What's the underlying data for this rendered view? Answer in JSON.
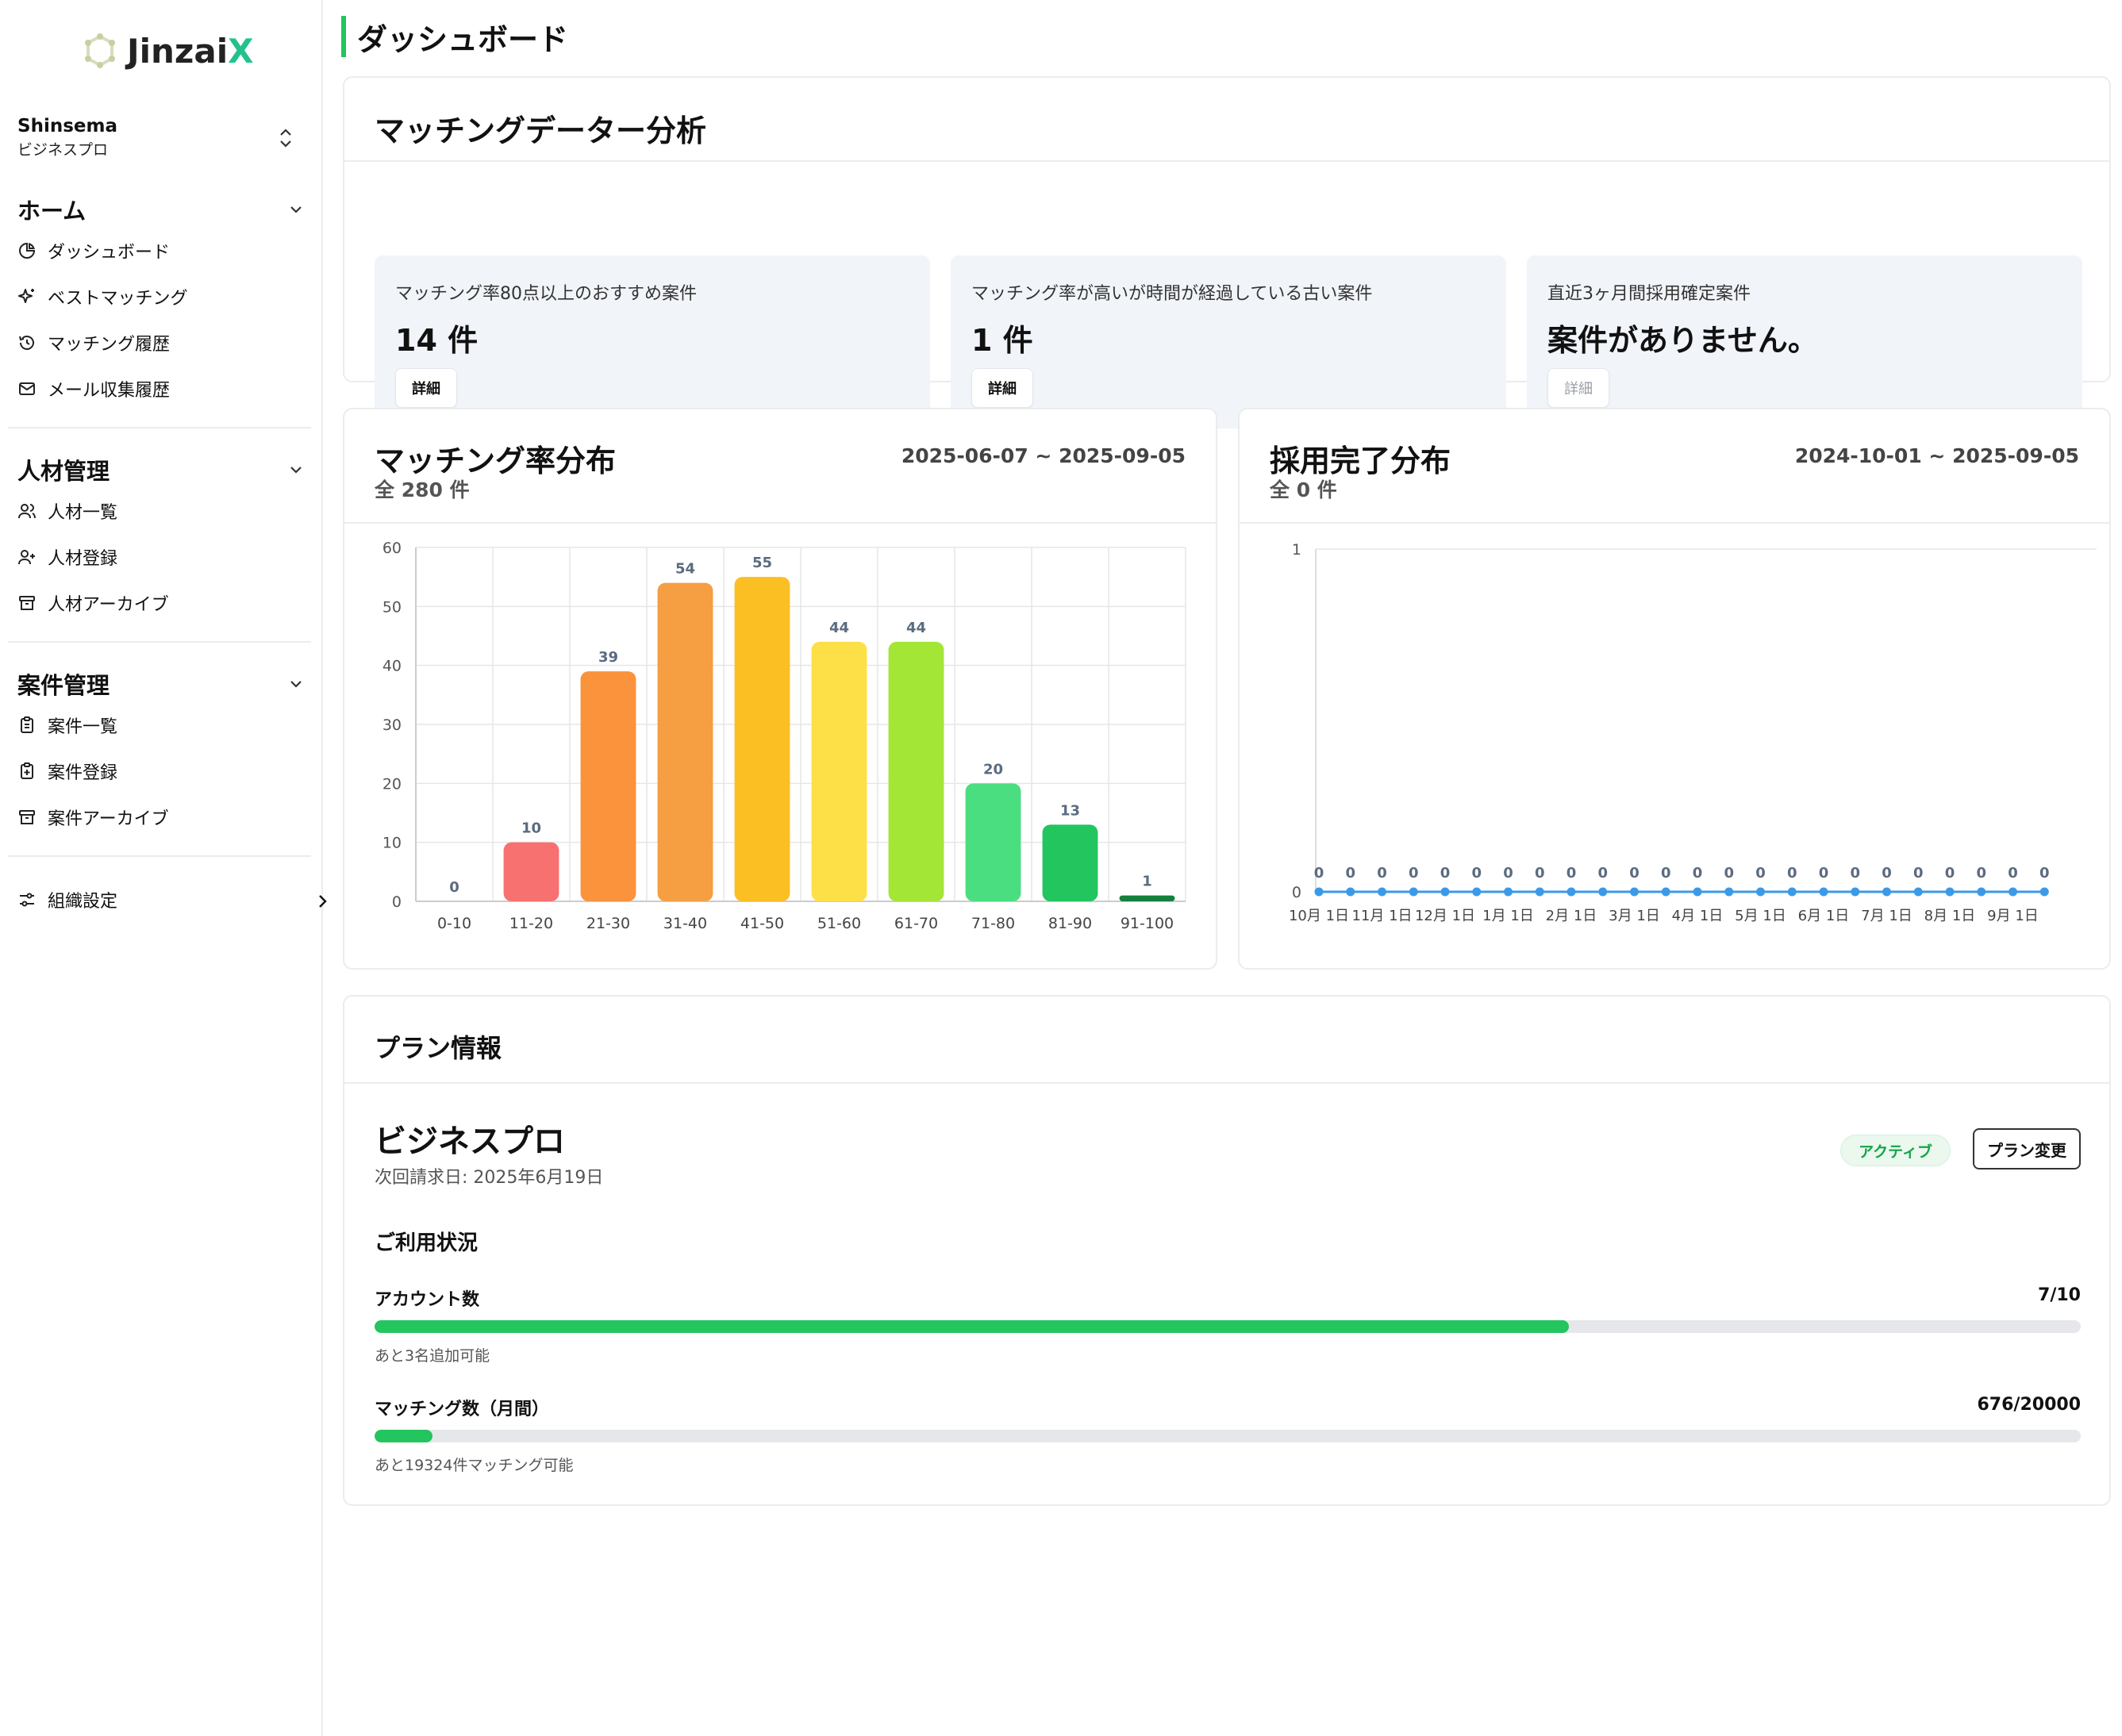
{
  "brand": {
    "name_prefix": "Jinzai",
    "name_suffix": "X",
    "accent": "#22c38a"
  },
  "org": {
    "name": "Shinsema",
    "plan": "ビジネスプロ"
  },
  "sidebar": {
    "home": {
      "title": "ホーム",
      "items": [
        {
          "label": "ダッシュボード",
          "icon": "pie-chart-icon"
        },
        {
          "label": "ベストマッチング",
          "icon": "sparkles-icon"
        },
        {
          "label": "マッチング履歴",
          "icon": "history-icon"
        },
        {
          "label": "メール収集履歴",
          "icon": "mail-icon"
        }
      ]
    },
    "talent": {
      "title": "人材管理",
      "items": [
        {
          "label": "人材一覧",
          "icon": "users-icon"
        },
        {
          "label": "人材登録",
          "icon": "user-plus-icon"
        },
        {
          "label": "人材アーカイブ",
          "icon": "archive-icon"
        }
      ]
    },
    "projects": {
      "title": "案件管理",
      "items": [
        {
          "label": "案件一覧",
          "icon": "clipboard-list-icon"
        },
        {
          "label": "案件登録",
          "icon": "clipboard-plus-icon"
        },
        {
          "label": "案件アーカイブ",
          "icon": "archive-icon"
        }
      ]
    },
    "settings": {
      "label": "組織設定",
      "icon": "settings-sliders-icon"
    }
  },
  "page": {
    "title": "ダッシュボード"
  },
  "analysis": {
    "title": "マッチングデーター分析",
    "cards": [
      {
        "label": "マッチング率80点以上のおすすめ案件",
        "value": "14 件",
        "button": "詳細",
        "enabled": true
      },
      {
        "label": "マッチング率が高いが時間が経過している古い案件",
        "value": "1 件",
        "button": "詳細",
        "enabled": true
      },
      {
        "label": "直近3ヶ月間採用確定案件",
        "value": "案件がありません。",
        "button": "詳細",
        "enabled": false
      }
    ]
  },
  "match_dist": {
    "title": "マッチング率分布",
    "total": "全 280 件",
    "range": "2025-06-07 ~ 2025-09-05"
  },
  "hire_dist": {
    "title": "採用完了分布",
    "total": "全 0 件",
    "range": "2024-10-01 ~ 2025-09-05"
  },
  "chart_data": [
    {
      "type": "bar",
      "categories": [
        "0-10",
        "11-20",
        "21-30",
        "31-40",
        "41-50",
        "51-60",
        "61-70",
        "71-80",
        "81-90",
        "91-100"
      ],
      "values": [
        0,
        10,
        39,
        54,
        55,
        44,
        44,
        20,
        13,
        1
      ],
      "colors": [
        "#f87171",
        "#f87171",
        "#fb923c",
        "#f59e42",
        "#fbbf24",
        "#fde047",
        "#a3e635",
        "#4ade80",
        "#22c55e",
        "#15803d"
      ],
      "ylim": [
        0,
        60
      ],
      "yticks": [
        0,
        10,
        20,
        30,
        40,
        50,
        60
      ],
      "data_labels": true,
      "grid": true
    },
    {
      "type": "line",
      "x": [
        "10月 1日",
        "",
        "11月 1日",
        "",
        "12月 1日",
        "",
        "1月 1日",
        "",
        "2月 1日",
        "",
        "3月 1日",
        "",
        "4月 1日",
        "",
        "5月 1日",
        "",
        "6月 1日",
        "",
        "7月 1日",
        "",
        "8月 1日",
        "",
        "9月 1日",
        ""
      ],
      "values": [
        0,
        0,
        0,
        0,
        0,
        0,
        0,
        0,
        0,
        0,
        0,
        0,
        0,
        0,
        0,
        0,
        0,
        0,
        0,
        0,
        0,
        0,
        0,
        0
      ],
      "color": "#3b9ae8",
      "ylim": [
        0,
        1
      ],
      "yticks": [
        0,
        1
      ],
      "data_labels": true,
      "grid": false
    }
  ],
  "plan": {
    "section_title": "プラン情報",
    "name": "ビジネスプロ",
    "next_billing": "次回請求日: 2025年6月19日",
    "status": "アクティブ",
    "change_button": "プラン変更",
    "usage_title": "ご利用状況",
    "accounts": {
      "label": "アカウント数",
      "count": "7/10",
      "fraction": 0.7,
      "note": "あと3名追加可能"
    },
    "matching": {
      "label": "マッチング数（月間）",
      "count": "676/20000",
      "fraction": 0.0338,
      "note": "あと19324件マッチング可能"
    }
  }
}
